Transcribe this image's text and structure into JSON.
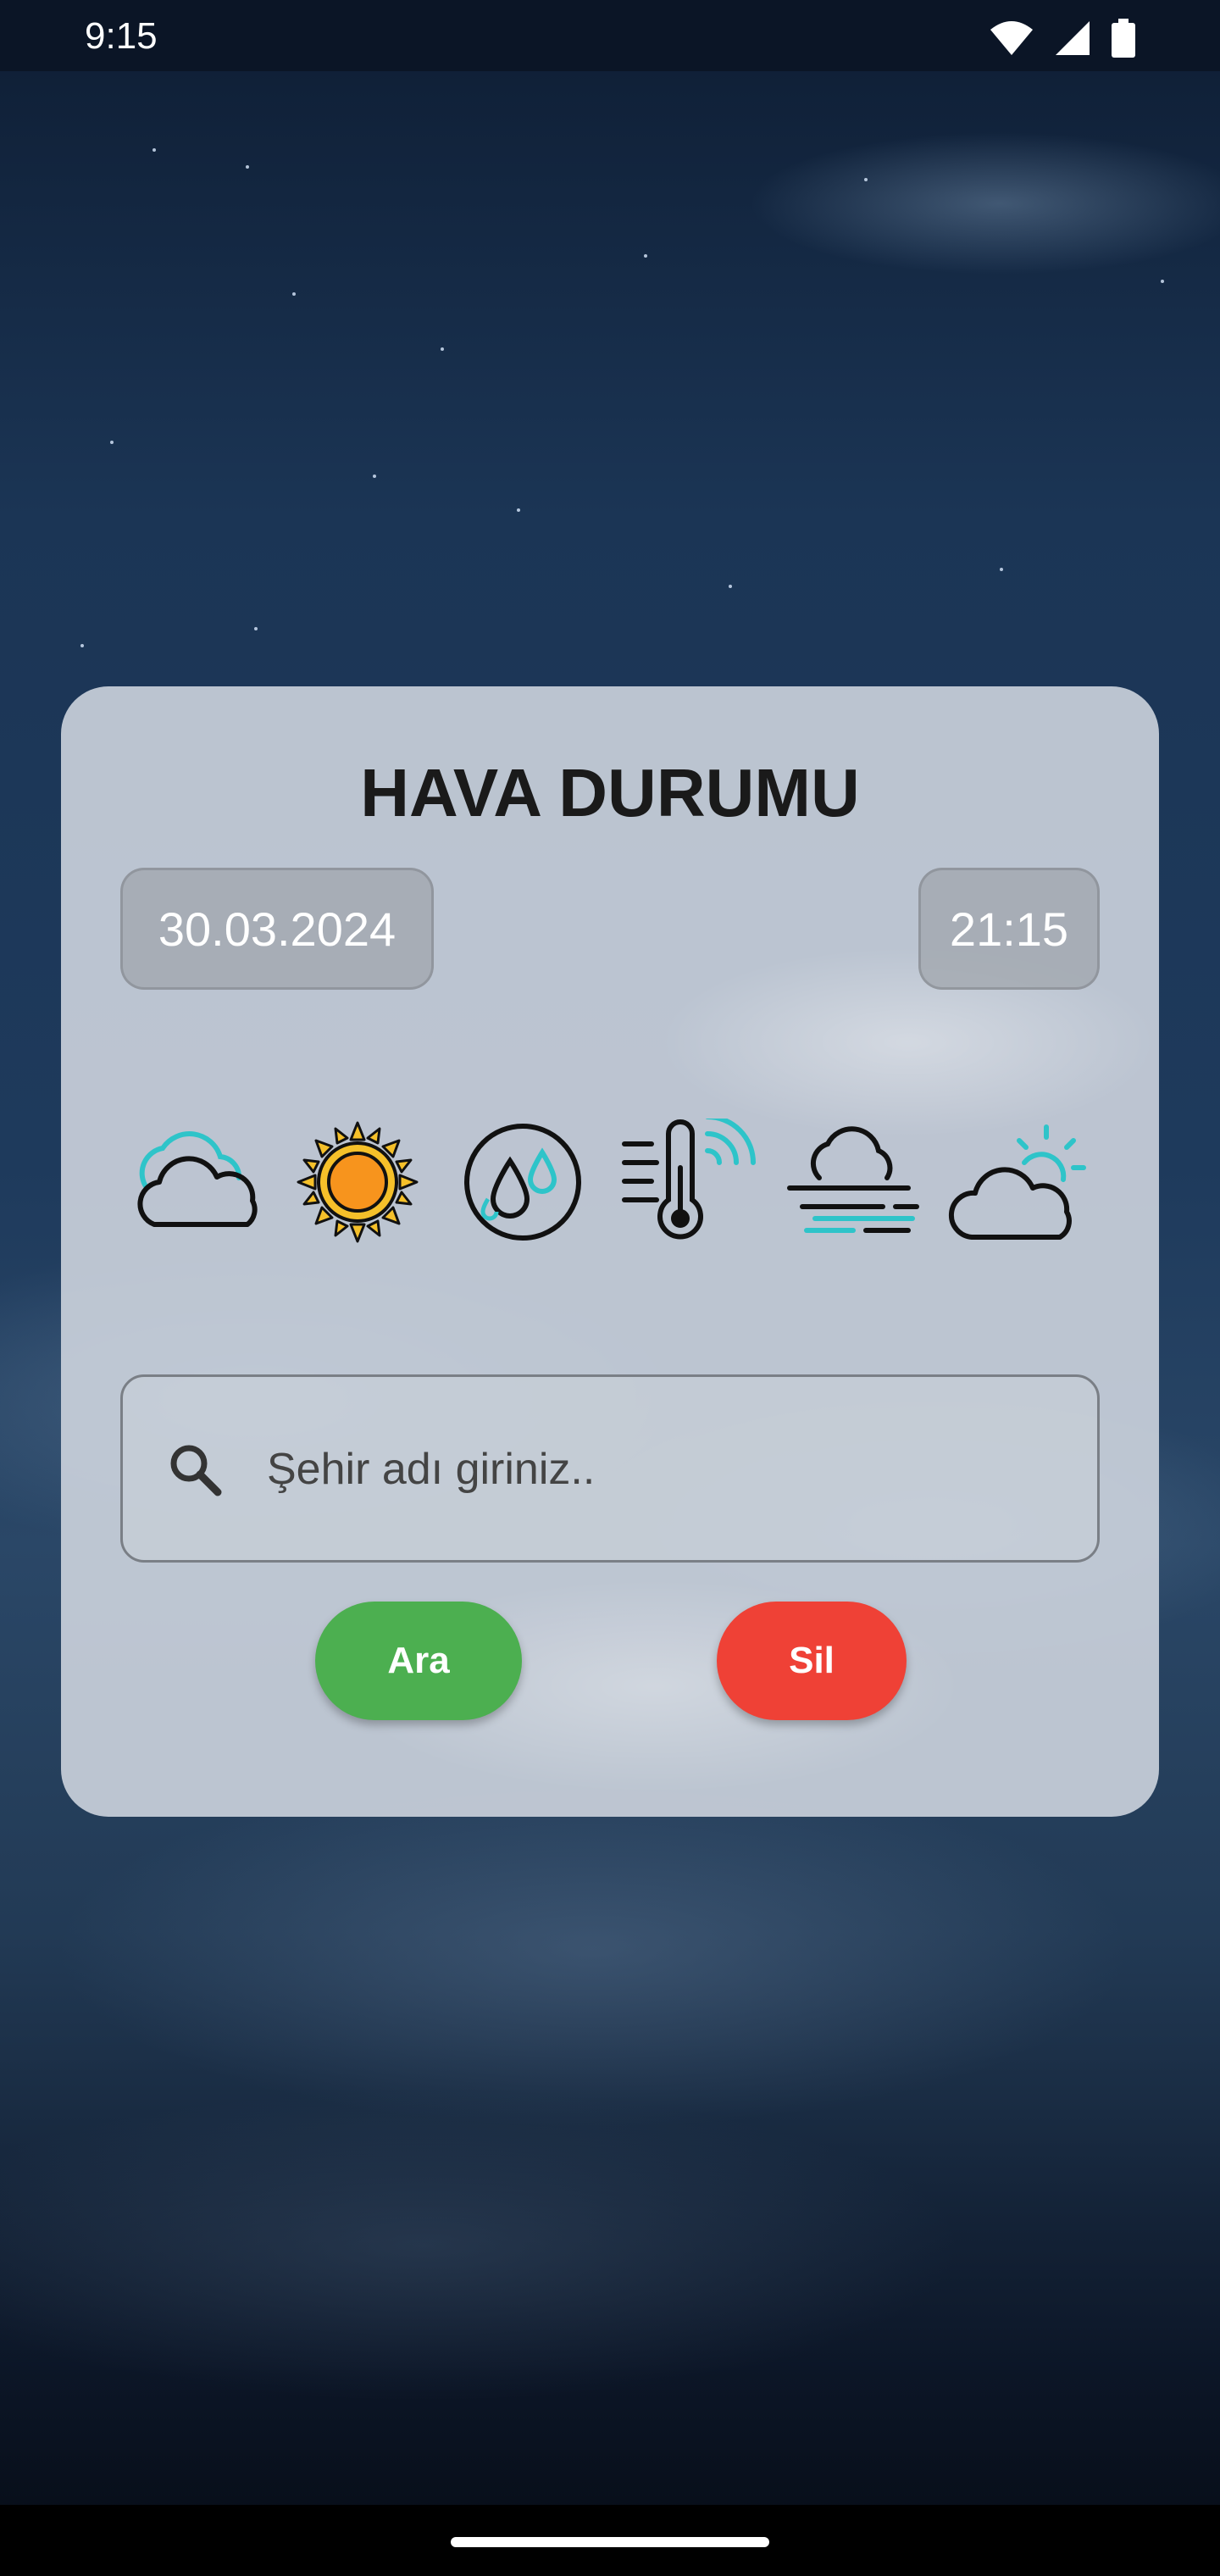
{
  "status_bar": {
    "time": "9:15"
  },
  "app": {
    "title": "HAVA DURUMU",
    "date": "30.03.2024",
    "time": "21:15",
    "weather_icons": [
      "cloudy-icon",
      "sun-icon",
      "humidity-icon",
      "thermometer-wind-icon",
      "fog-icon",
      "partly-cloudy-icon"
    ],
    "search": {
      "placeholder": "Şehir adı giriniz..",
      "value": ""
    },
    "buttons": {
      "search_label": "Ara",
      "clear_label": "Sil"
    }
  },
  "colors": {
    "search_button": "#4caf50",
    "clear_button": "#ef4136",
    "icon_accent": "#2ec4c9",
    "sun": "#f7941d"
  }
}
